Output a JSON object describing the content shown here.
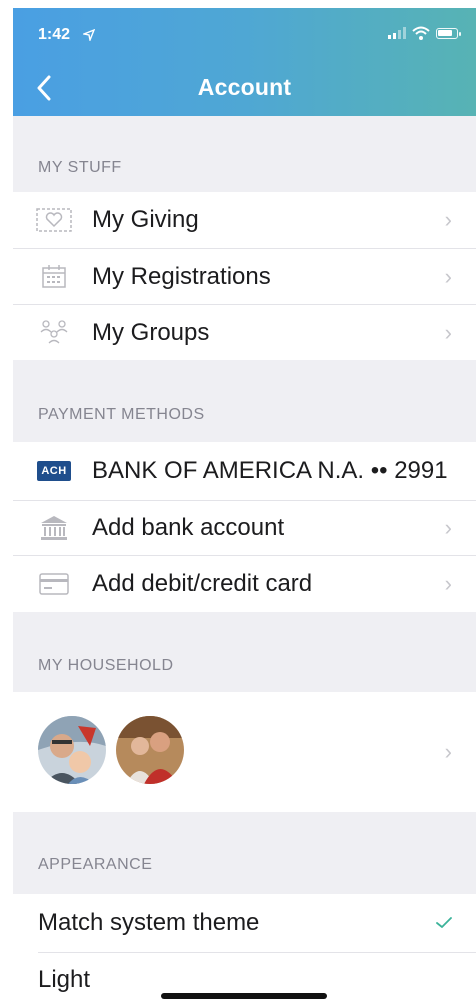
{
  "status_bar": {
    "time": "1:42"
  },
  "header": {
    "title": "Account"
  },
  "sections": {
    "my_stuff": {
      "title": "MY STUFF",
      "items": [
        {
          "label": "My Giving",
          "icon": "envelope-heart-icon"
        },
        {
          "label": "My Registrations",
          "icon": "calendar-icon"
        },
        {
          "label": "My Groups",
          "icon": "group-people-icon"
        }
      ]
    },
    "payment_methods": {
      "title": "PAYMENT METHODS",
      "ach_badge": "ACH",
      "bank_account": "BANK OF AMERICA N.A. •• 2991",
      "add_bank": "Add bank account",
      "add_card": "Add debit/credit card"
    },
    "my_household": {
      "title": "MY HOUSEHOLD"
    },
    "appearance": {
      "title": "APPEARANCE",
      "options": [
        {
          "label": "Match system theme",
          "selected": true
        },
        {
          "label": "Light",
          "selected": false
        }
      ]
    }
  },
  "colors": {
    "header_start": "#4a9fe3",
    "header_end": "#57b3b4",
    "check": "#3cb39a",
    "section_bg": "#efeff3"
  }
}
